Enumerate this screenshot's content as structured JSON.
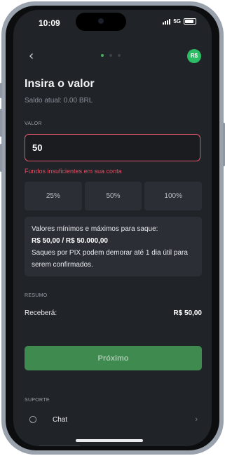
{
  "status_bar": {
    "time": "10:09",
    "network": "5G"
  },
  "nav": {
    "back_icon": "chevron-left-icon",
    "step_count": 3,
    "active_step": 1,
    "brand_badge": "R$"
  },
  "page": {
    "title": "Insira o valor",
    "balance": "Saldo atual: 0.00 BRL"
  },
  "amount": {
    "label": "VALOR",
    "value": "50",
    "error": "Fundos insuficientes em sua conta"
  },
  "percent_buttons": [
    "25%",
    "50%",
    "100%"
  ],
  "info": {
    "line1": "Valores mínimos e máximos para saque:",
    "line2": "R$ 50,00 / R$ 50.000,00",
    "line3": "Saques por PIX podem demorar até 1 dia útil para serem confirmados."
  },
  "summary": {
    "label": "RESUMO",
    "receive_label": "Receberá:",
    "receive_value": "R$ 50,00"
  },
  "next_button": "Próximo",
  "support": {
    "label": "SUPORTE",
    "chat_label": "Chat"
  },
  "colors": {
    "background": "#202328",
    "accent_green": "#3f8a4f",
    "error_red": "#e34d62",
    "card": "#2b2f35"
  }
}
